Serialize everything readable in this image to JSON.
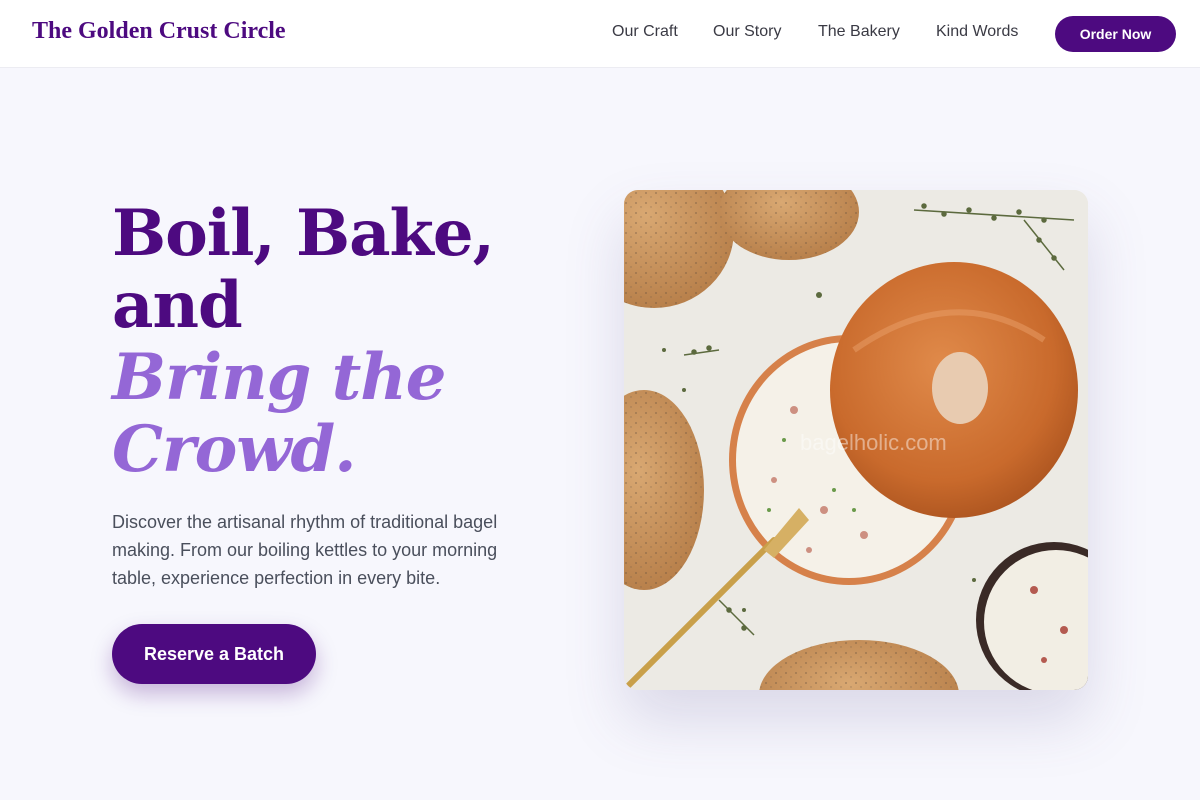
{
  "brand": {
    "name": "The Golden Crust Circle"
  },
  "nav": {
    "links": [
      {
        "label": "Our Craft"
      },
      {
        "label": "Our Story"
      },
      {
        "label": "The Bakery"
      },
      {
        "label": "Kind Words"
      }
    ],
    "cta_label": "Order Now"
  },
  "hero": {
    "title_line1": "Boil, Bake,",
    "title_line2": "and",
    "title_accent_line1": "Bring the",
    "title_accent_line2": "Crowd.",
    "description": "Discover the artisanal rhythm of traditional bagel making. From our boiling kettles to your morning table, experience perfection in every bite.",
    "cta_label": "Reserve a Batch",
    "image": {
      "watermark": "bagelholic.com"
    }
  },
  "colors": {
    "brand_purple": "#4d0a80",
    "accent_lavender": "#9467d6",
    "page_background": "#f7f7fd"
  }
}
